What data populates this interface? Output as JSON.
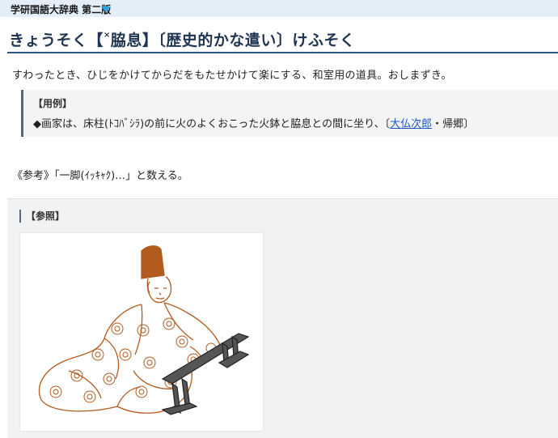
{
  "header": {
    "dictionary_name": "学研国語大辞典 第二版"
  },
  "entry": {
    "headword": "きょうそく【",
    "headword_mark": "×",
    "headword_kanji": "脇息】〔歴史的かな遣い〕けふそく",
    "definition": "すわったとき、ひじをかけてからだをもたせかけて楽にする、和室用の道具。おしまずき。",
    "example_title": "【用例】",
    "example_text_before": "◆画家は、床柱(ﾄｺﾊﾞｼﾗ)の前に火のよくおこった火鉢と脇息との間に坐り、〔",
    "example_link": "大仏次郎",
    "example_text_after": "・帰郷〕",
    "note": "《参考》「一脚(ｲｯｷｬｸ)…」と数える。",
    "reference_title": "【参照】"
  },
  "colors": {
    "topbar": "#e3eef8",
    "accent": "#2aa7df",
    "headword": "#1f3552",
    "link": "#1a55c8",
    "illustration": "#b35a1f"
  }
}
